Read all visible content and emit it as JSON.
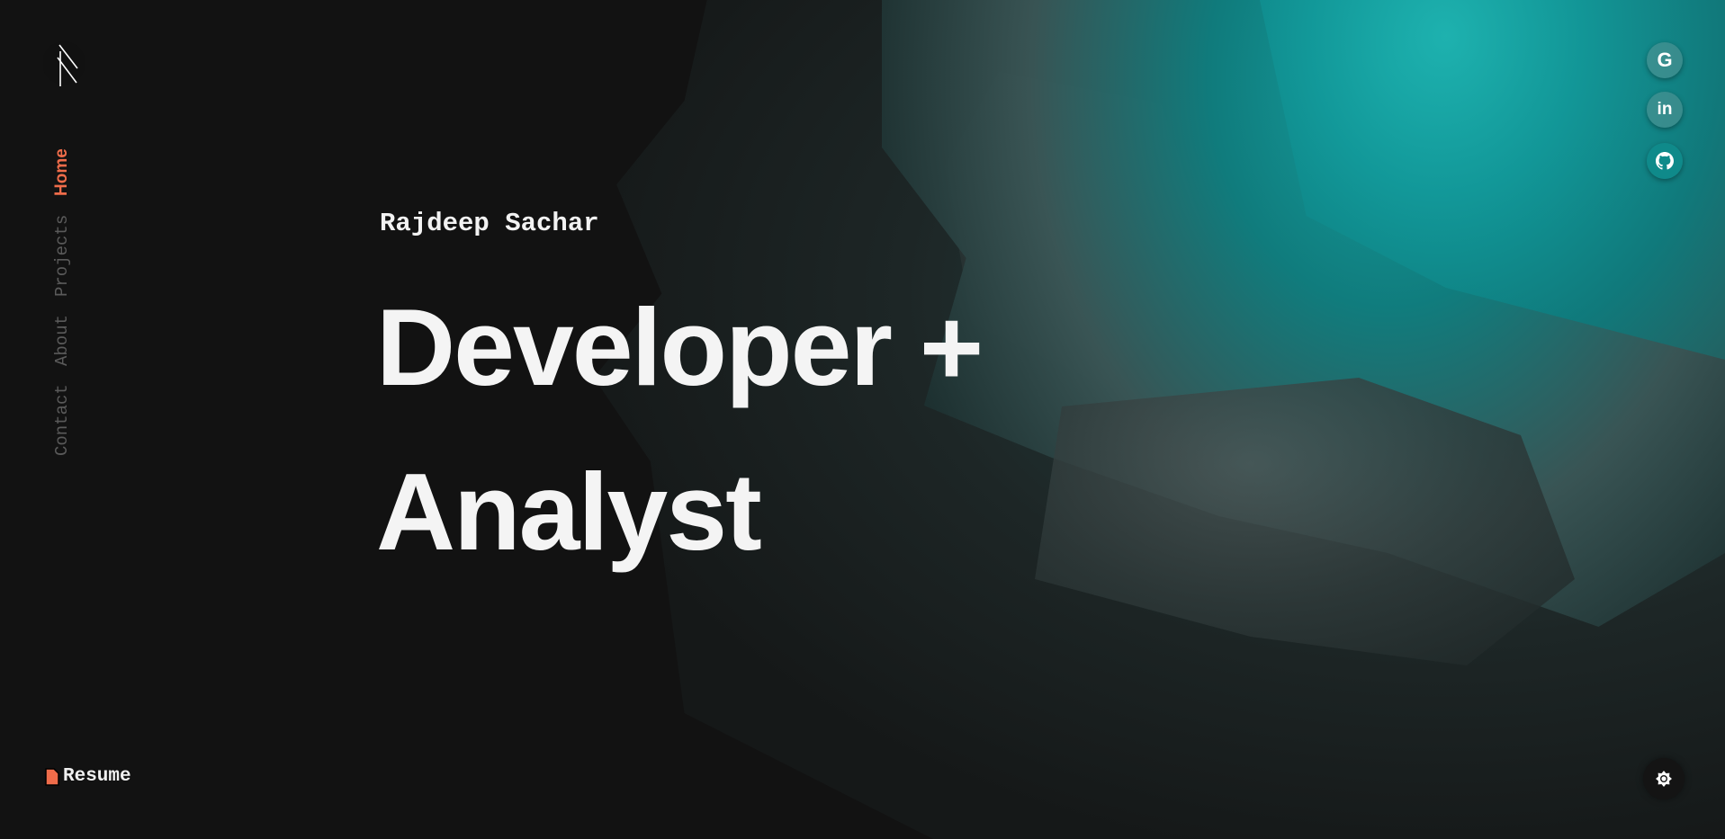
{
  "nav": {
    "items": [
      {
        "label": "Home",
        "active": true
      },
      {
        "label": "Projects"
      },
      {
        "label": "About"
      },
      {
        "label": "Contact"
      }
    ]
  },
  "hero": {
    "name": "Rajdeep Sachar",
    "line1": "Developer +",
    "line2": "Analyst"
  },
  "social": [
    {
      "icon": "google-icon",
      "label": "G"
    },
    {
      "icon": "linkedin-icon",
      "label": "in"
    },
    {
      "icon": "github-icon"
    }
  ],
  "resume": {
    "label": "Resume",
    "icon": "file-icon"
  },
  "theme_toggle": {
    "icon": "brightness-icon"
  },
  "colors": {
    "accent": "#ef6c4a",
    "background": "#121212",
    "teal": "#12999a"
  }
}
